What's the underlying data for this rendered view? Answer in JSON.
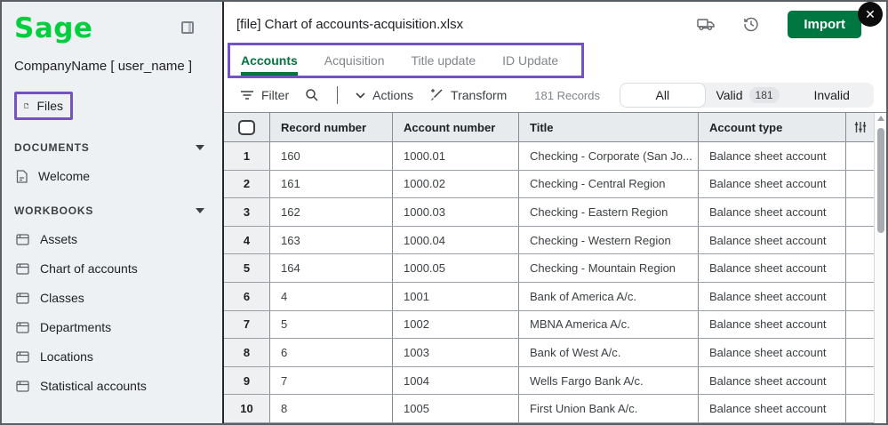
{
  "colors": {
    "logo_green": "#00CE3C",
    "action_green": "#007641",
    "highlight_purple": "#7452C6",
    "sidebar_bg": "#EEF1F3",
    "table_header_bg": "#E8EBEE"
  },
  "sidebar": {
    "logo": "Sage",
    "company": "CompanyName [ user_name ]",
    "files_label": "Files",
    "sections": [
      {
        "label": "DOCUMENTS",
        "items": [
          {
            "label": "Welcome"
          }
        ]
      },
      {
        "label": "WORKBOOKS",
        "items": [
          {
            "label": "Assets"
          },
          {
            "label": "Chart of accounts"
          },
          {
            "label": "Classes"
          },
          {
            "label": "Departments"
          },
          {
            "label": "Locations"
          },
          {
            "label": "Statistical accounts"
          }
        ]
      }
    ]
  },
  "header": {
    "title": "[file] Chart of accounts-acquisition.xlsx",
    "import_label": "Import",
    "close_glyph": "✕"
  },
  "tabs": [
    {
      "label": "Accounts",
      "active": true
    },
    {
      "label": "Acquisition",
      "active": false
    },
    {
      "label": "Title update",
      "active": false
    },
    {
      "label": "ID Update",
      "active": false
    }
  ],
  "toolbar": {
    "filter_label": "Filter",
    "actions_label": "Actions",
    "transform_label": "Transform",
    "records_label": "181 Records",
    "segments": {
      "all": "All",
      "valid": "Valid",
      "valid_count": "181",
      "invalid": "Invalid"
    }
  },
  "table": {
    "columns": {
      "record": "Record number",
      "account": "Account number",
      "title": "Title",
      "type": "Account type"
    },
    "rows": [
      {
        "num": "1",
        "record": "160",
        "account": "1000.01",
        "title": "Checking - Corporate (San Jo...",
        "type": "Balance sheet account"
      },
      {
        "num": "2",
        "record": "161",
        "account": "1000.02",
        "title": "Checking - Central Region",
        "type": "Balance sheet account"
      },
      {
        "num": "3",
        "record": "162",
        "account": "1000.03",
        "title": "Checking - Eastern Region",
        "type": "Balance sheet account"
      },
      {
        "num": "4",
        "record": "163",
        "account": "1000.04",
        "title": "Checking - Western Region",
        "type": "Balance sheet account"
      },
      {
        "num": "5",
        "record": "164",
        "account": "1000.05",
        "title": "Checking - Mountain Region",
        "type": "Balance sheet account"
      },
      {
        "num": "6",
        "record": "4",
        "account": "1001",
        "title": "Bank of America A/c.",
        "type": "Balance sheet account"
      },
      {
        "num": "7",
        "record": "5",
        "account": "1002",
        "title": "MBNA America A/c.",
        "type": "Balance sheet account"
      },
      {
        "num": "8",
        "record": "6",
        "account": "1003",
        "title": "Bank of West A/c.",
        "type": "Balance sheet account"
      },
      {
        "num": "9",
        "record": "7",
        "account": "1004",
        "title": "Wells Fargo Bank A/c.",
        "type": "Balance sheet account"
      },
      {
        "num": "10",
        "record": "8",
        "account": "1005",
        "title": "First Union Bank A/c.",
        "type": "Balance sheet account"
      }
    ]
  }
}
